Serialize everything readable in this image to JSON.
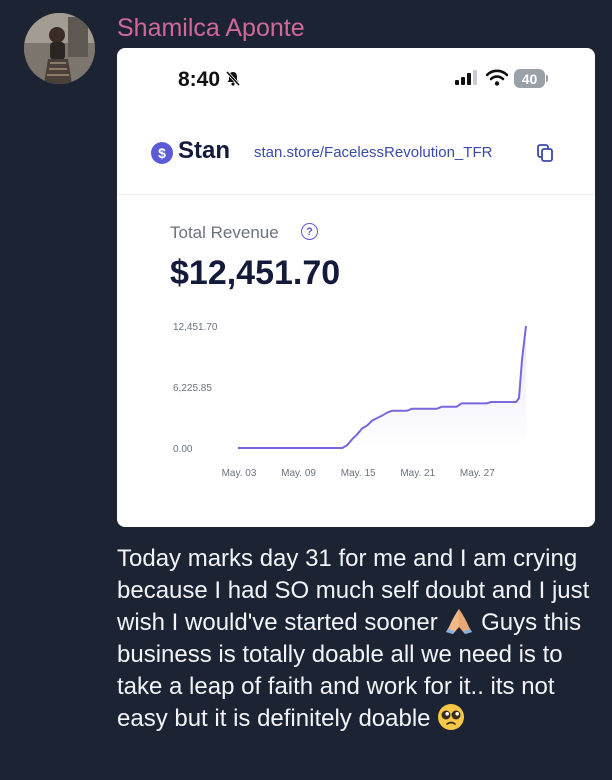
{
  "sender": {
    "name": "Shamilca Aponte"
  },
  "screenshot": {
    "status_bar": {
      "time": "8:40",
      "battery": "40"
    },
    "header": {
      "brand": "Stan",
      "store_url": "stan.store/FacelessRevolution_TFR"
    },
    "revenue": {
      "label": "Total Revenue",
      "help_glyph": "?",
      "amount": "$12,451.70"
    },
    "chart_data": {
      "type": "area",
      "title": "",
      "xlabel": "",
      "ylabel": "",
      "y_ticks": [
        "12,451.70",
        "6,225.85",
        "0.00"
      ],
      "ylim": [
        0,
        12451.7
      ],
      "x_ticks": [
        "May. 03",
        "May. 09",
        "May. 15",
        "May. 21",
        "May. 27"
      ],
      "x_tick_days": [
        3,
        9,
        15,
        21,
        27
      ],
      "xlim_days": [
        3,
        32
      ],
      "grid": false,
      "color": "#7b66dd",
      "points": [
        {
          "day": 3,
          "value": 0
        },
        {
          "day": 13.5,
          "value": 0
        },
        {
          "day": 14,
          "value": 300
        },
        {
          "day": 14.5,
          "value": 900
        },
        {
          "day": 15,
          "value": 1400
        },
        {
          "day": 15.5,
          "value": 2000
        },
        {
          "day": 16,
          "value": 2300
        },
        {
          "day": 16.5,
          "value": 2800
        },
        {
          "day": 17,
          "value": 3050
        },
        {
          "day": 17.5,
          "value": 3300
        },
        {
          "day": 18,
          "value": 3600
        },
        {
          "day": 18.5,
          "value": 3800
        },
        {
          "day": 19,
          "value": 3800
        },
        {
          "day": 20,
          "value": 3800
        },
        {
          "day": 20.5,
          "value": 4000
        },
        {
          "day": 23,
          "value": 4000
        },
        {
          "day": 23.5,
          "value": 4200
        },
        {
          "day": 25,
          "value": 4200
        },
        {
          "day": 25.5,
          "value": 4550
        },
        {
          "day": 28,
          "value": 4550
        },
        {
          "day": 28.5,
          "value": 4700
        },
        {
          "day": 31,
          "value": 4700
        },
        {
          "day": 31.3,
          "value": 5100
        },
        {
          "day": 31.6,
          "value": 9000
        },
        {
          "day": 32,
          "value": 12451.7
        }
      ]
    }
  },
  "message": {
    "text_before": "Today marks day 31 for me and I am crying because I had SO much self doubt and I just wish I would've started sooner",
    "text_middle": "Guys this business is totally doable all we need is to take a leap of faith and work for it.. its not easy but it is definitely doable",
    "emojis": [
      "folded-hands-emoji",
      "pleading-face-emoji"
    ]
  },
  "colors": {
    "background": "#1c2433",
    "sender_name": "#d0689b",
    "chart_line": "#7b66dd",
    "brand_navy": "#131a3a"
  }
}
